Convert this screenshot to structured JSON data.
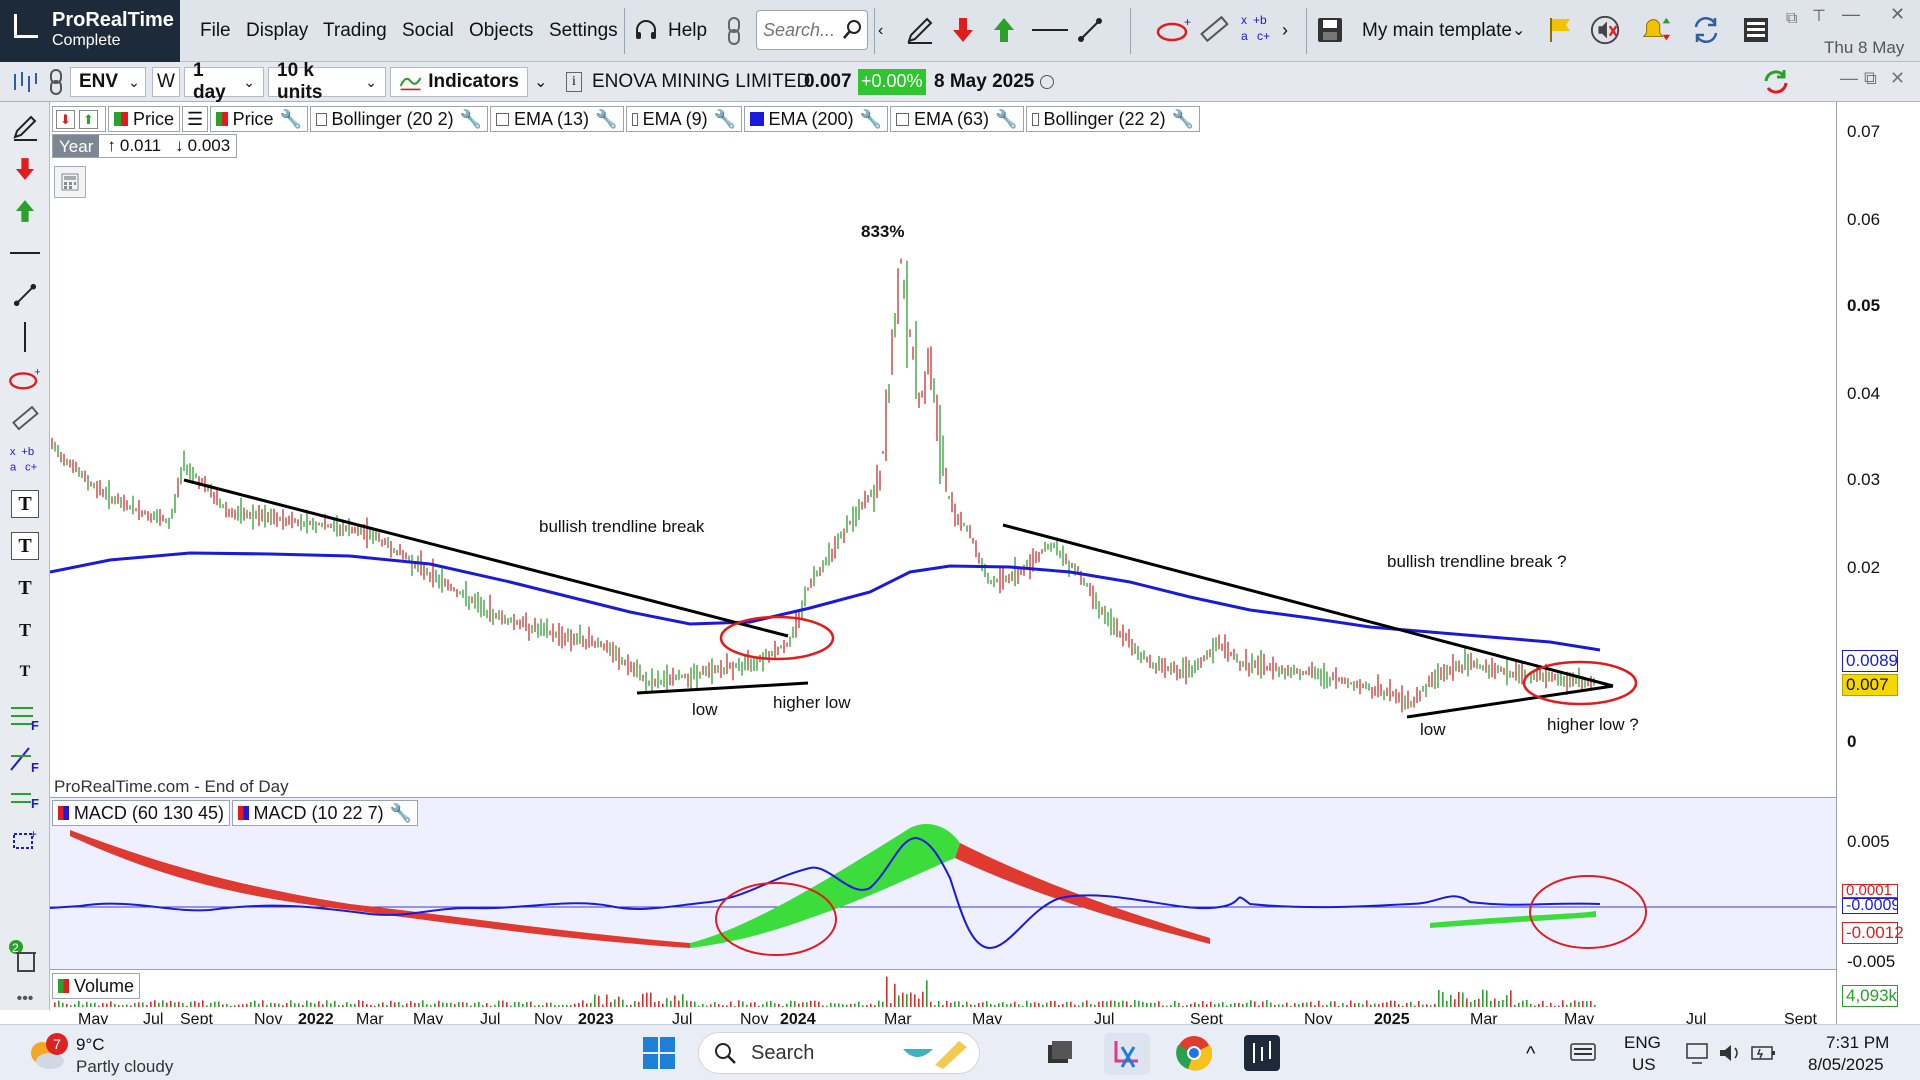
{
  "app": {
    "brand": "ProRealTime",
    "edition": "Complete"
  },
  "menu": {
    "file": "File",
    "display": "Display",
    "trading": "Trading",
    "social": "Social",
    "objects": "Objects",
    "settings": "Settings",
    "help": "Help"
  },
  "search": {
    "placeholder": "Search..."
  },
  "template": {
    "label": "My main template"
  },
  "clock": {
    "date": "Thu 8 May"
  },
  "toolbar": {
    "ticker": "ENV",
    "period_w": "W",
    "timeframe": "1 day",
    "units": "10 k units",
    "indicators": "Indicators"
  },
  "instrument": {
    "name": "ENOVA MINING LIMITED",
    "price": "0.007",
    "change": "+0.00%",
    "date": "8 May 2025"
  },
  "legend": {
    "price1": "Price",
    "price2": "Price",
    "bollinger1": "Bollinger (20 2)",
    "ema13": "EMA (13)",
    "ema9": "EMA (9)",
    "ema200": "EMA (200)",
    "ema63": "EMA (63)",
    "bollinger2": "Bollinger (22 2)"
  },
  "range": {
    "label": "Year",
    "high": "0.011",
    "low": "0.003"
  },
  "watermark": "ProRealTime.com - End of Day",
  "macd_legend": {
    "macd1": "MACD (60 130 45)",
    "macd2": "MACD (10 22 7)"
  },
  "volume_legend": "Volume",
  "annotations": {
    "peak": "833%",
    "break1": "bullish trendline break",
    "break2": "bullish trendline break ?",
    "low1": "low",
    "higher_low1": "higher low",
    "low2": "low",
    "higher_low2": "higher low ?"
  },
  "yaxis": {
    "labels": [
      "0.07",
      "0.06",
      "0.05",
      "0.04",
      "0.03",
      "0.02",
      "0"
    ],
    "ema_tag": "0.0089",
    "price_tag": "0.007",
    "macd_labels": [
      "0.005",
      "-0.005"
    ],
    "macd_tag1": "0.0001",
    "macd_tag2": "-0.0009",
    "macd_tag3": "-0.0012",
    "volume_tag": "4,093k"
  },
  "xaxis": [
    "May",
    "Jul",
    "Sept",
    "Nov",
    "2022",
    "Mar",
    "May",
    "Jul",
    "Nov",
    "2023",
    "Jul",
    "Nov",
    "2024",
    "Mar",
    "May",
    "Jul",
    "Sept",
    "Nov",
    "2025",
    "Mar",
    "May",
    "Jul",
    "Sept"
  ],
  "taskbar": {
    "temp": "9°C",
    "weather": "Partly cloudy",
    "badge": "7",
    "search": "Search",
    "lang1": "ENG",
    "lang2": "US",
    "time": "7:31 PM",
    "date": "8/05/2025"
  },
  "colors": {
    "ema": "#1a1adb",
    "up": "#2e9e2e",
    "down": "#d03030",
    "brand": "#1d2a3a",
    "highlight": "#2fc52f",
    "price_tag": "#f5d800"
  }
}
